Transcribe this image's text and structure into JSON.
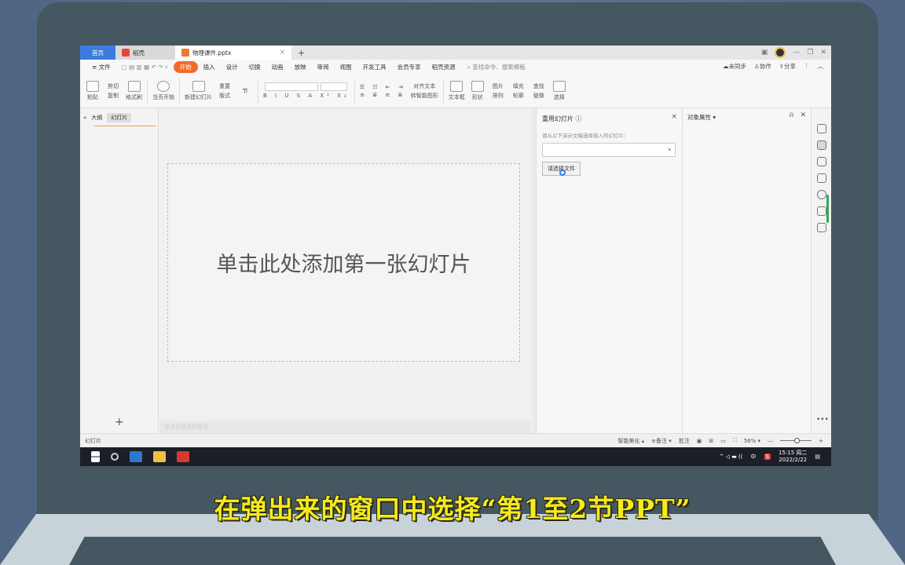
{
  "caption": "在弹出来的窗口中选择“第1至2节PPT”",
  "tabs": {
    "home": "首页",
    "docer": "稻壳",
    "file": "物理课件.pptx",
    "close": "×",
    "add": "+"
  },
  "window": {
    "min": "—",
    "max": "❐",
    "close": "✕"
  },
  "menu": {
    "file": "≡ 文件",
    "items": [
      "开始",
      "插入",
      "设计",
      "切换",
      "动画",
      "放映",
      "审阅",
      "视图",
      "开发工具",
      "会员专享",
      "稻壳资源"
    ],
    "search": "查找命令、搜索模板",
    "sync": "未同步",
    "collab": "协作",
    "share": "分享"
  },
  "ribbon": {
    "paste": "粘贴",
    "cut": "剪切",
    "copy": "复制",
    "format_painter": "格式刷",
    "from_current": "当页开始",
    "new_slide": "新建幻灯片",
    "layout": "版式",
    "section": "节",
    "reset": "重置",
    "text_box": "文本框",
    "shape": "形状",
    "arrange": "排列",
    "find": "查找",
    "replace": "替换",
    "select": "选择",
    "picture": "图片",
    "fill": "填充",
    "outline": "轮廓",
    "align_text": "对齐文本",
    "smartart": "转智能图形"
  },
  "left_pane": {
    "collapse": "«",
    "outline": "大纲",
    "slides": "幻灯片",
    "add": "+"
  },
  "slide": {
    "placeholder": "单击此处添加第一张幻灯片"
  },
  "notes": {
    "placeholder": "单击此处添加备注"
  },
  "reuse_panel": {
    "title": "重用幻灯片 ⓘ",
    "hint": "请从以下演示文稿选择插入的幻灯片：",
    "browse_button": "请选择文件",
    "close": "×"
  },
  "props_panel": {
    "title": "对象属性 ▾"
  },
  "status": {
    "left": "幻灯片",
    "beautify": "智能美化 ▴",
    "notes": "≡备注 ▾",
    "comment": "批注",
    "zoom": "56% ▾",
    "zoom_minus": "—",
    "zoom_plus": "+"
  },
  "taskbar": {
    "time": "15:15 周二",
    "date": "2022/2/22",
    "ime": "中"
  }
}
